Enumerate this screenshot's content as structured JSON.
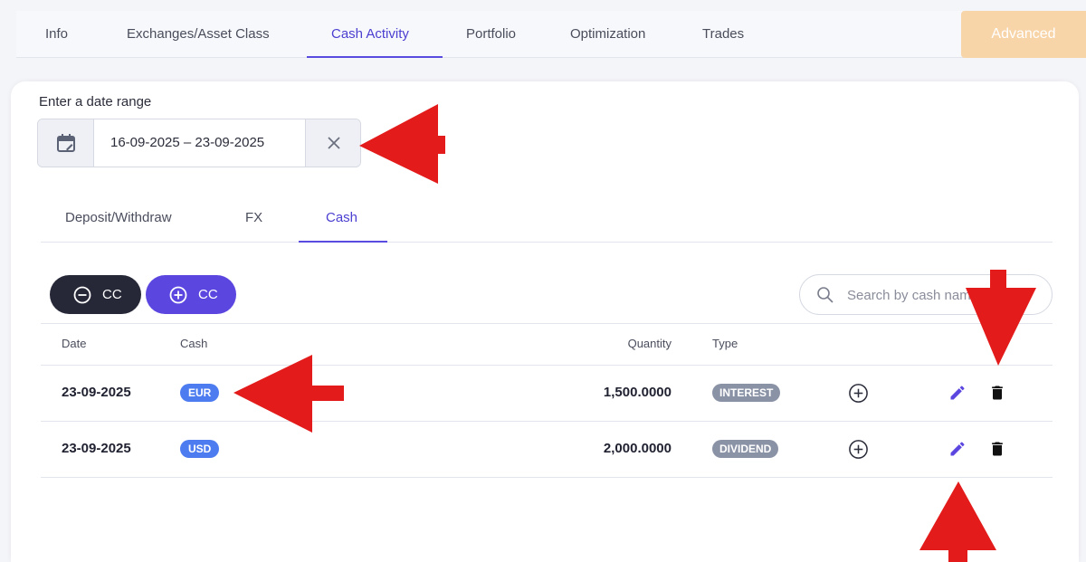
{
  "top_tabs": [
    {
      "label": "Info"
    },
    {
      "label": "Exchanges/Asset Class"
    },
    {
      "label": "Cash Activity"
    },
    {
      "label": "Portfolio"
    },
    {
      "label": "Optimization"
    },
    {
      "label": "Trades"
    }
  ],
  "active_top_tab": "Cash Activity",
  "advanced_label": "Advanced",
  "date_range": {
    "label": "Enter a date range",
    "value": "16-09-2025 – 23-09-2025"
  },
  "inner_tabs": [
    {
      "label": "Deposit/Withdraw"
    },
    {
      "label": "FX"
    },
    {
      "label": "Cash"
    }
  ],
  "active_inner_tab": "Cash",
  "actions": {
    "remove_label": "CC",
    "add_label": "CC"
  },
  "search": {
    "placeholder": "Search by cash name"
  },
  "table": {
    "headers": {
      "date": "Date",
      "cash": "Cash",
      "quantity": "Quantity",
      "type": "Type"
    },
    "rows": [
      {
        "date": "23-09-2025",
        "cash": "EUR",
        "quantity": "1,500.0000",
        "type": "INTEREST"
      },
      {
        "date": "23-09-2025",
        "cash": "USD",
        "quantity": "2,000.0000",
        "type": "DIVIDEND"
      }
    ]
  },
  "colors": {
    "accent": "#5a4be0",
    "advanced_button": "#f8d4a9",
    "currency_badge": "#4d7cf0",
    "type_badge": "#8a92a6",
    "annotation_arrow": "#e31b1b"
  },
  "icons": {
    "date_picker": "calendar-icon",
    "clear": "close-icon",
    "remove_cc": "minus-circle-icon",
    "add_cc": "plus-circle-icon",
    "search": "search-icon",
    "row_add": "plus-circle-icon",
    "row_edit": "pencil-icon",
    "row_delete": "trash-icon"
  }
}
